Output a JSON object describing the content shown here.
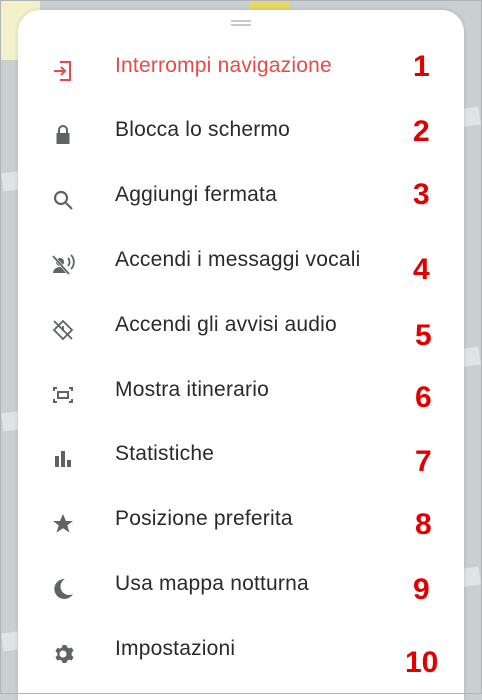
{
  "colors": {
    "accent_red": "#e84a4a",
    "text": "#2a2a2a",
    "icon_gray": "#5f6368",
    "badge_red": "#e00000"
  },
  "menu": {
    "items": [
      {
        "label": "Interrompi navigazione",
        "icon": "exit-icon",
        "number": "1"
      },
      {
        "label": "Blocca lo schermo",
        "icon": "lock-icon",
        "number": "2"
      },
      {
        "label": "Aggiungi fermata",
        "icon": "search-icon",
        "number": "3"
      },
      {
        "label": "Accendi i messaggi vocali",
        "icon": "voice-off-icon",
        "number": "4"
      },
      {
        "label": "Accendi gli avvisi audio",
        "icon": "alert-off-icon",
        "number": "5"
      },
      {
        "label": "Mostra itinerario",
        "icon": "route-overview-icon",
        "number": "6"
      },
      {
        "label": "Statistiche",
        "icon": "bar-chart-icon",
        "number": "7"
      },
      {
        "label": "Posizione preferita",
        "icon": "star-icon",
        "number": "8"
      },
      {
        "label": "Usa mappa notturna",
        "icon": "moon-icon",
        "number": "9"
      },
      {
        "label": "Impostazioni",
        "icon": "gear-icon",
        "number": "10"
      }
    ]
  }
}
